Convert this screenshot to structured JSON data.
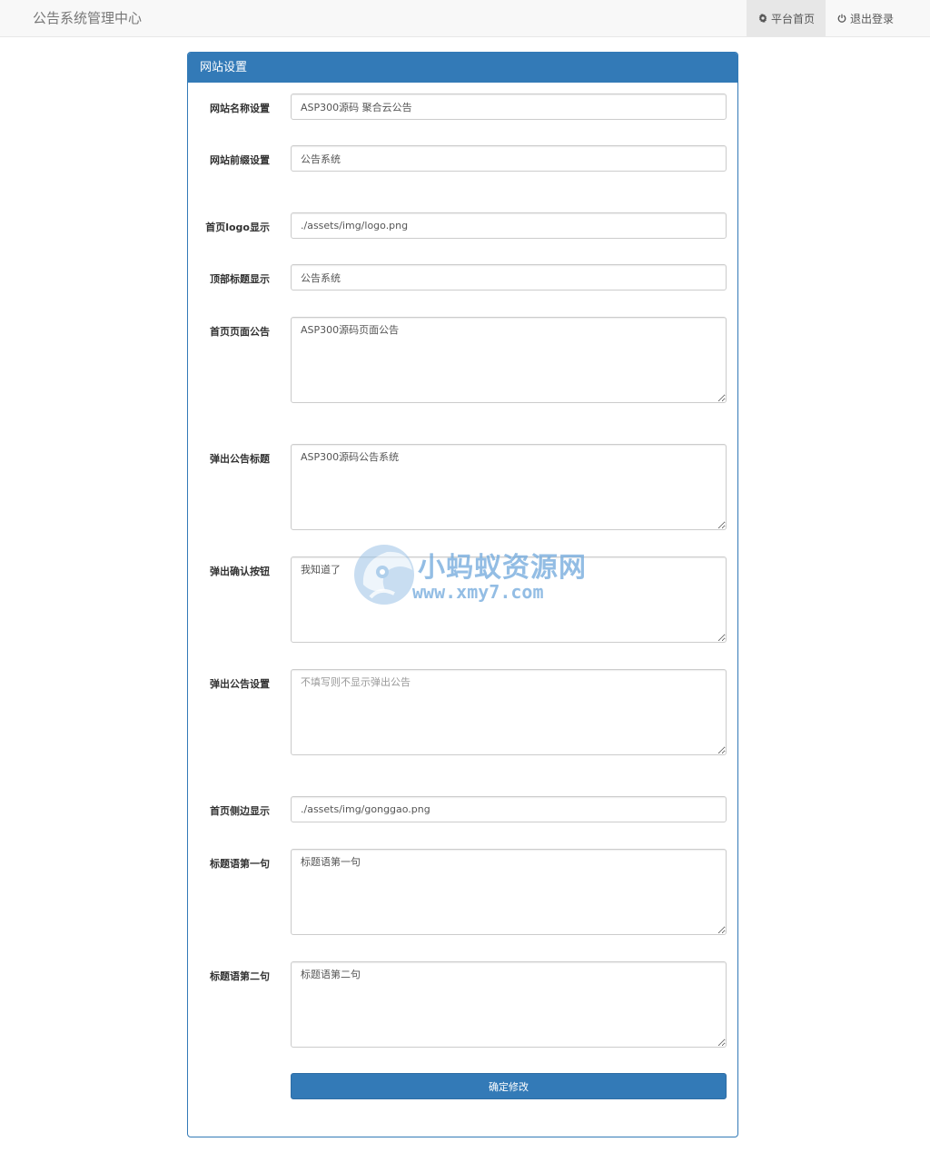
{
  "navbar": {
    "brand": "公告系统管理中心",
    "links": [
      {
        "label": "平台首页",
        "icon": "gear-icon",
        "active": true
      },
      {
        "label": "退出登录",
        "icon": "power-icon",
        "active": false
      }
    ]
  },
  "panel": {
    "title": "网站设置",
    "fields": [
      {
        "label": "网站名称设置",
        "type": "input",
        "value": "ASP300源码 聚合云公告",
        "placeholder": ""
      },
      {
        "label": "网站前缀设置",
        "type": "input",
        "value": "公告系统",
        "placeholder": ""
      },
      {
        "label": "首页logo显示",
        "type": "input",
        "value": "./assets/img/logo.png",
        "placeholder": ""
      },
      {
        "label": "顶部标题显示",
        "type": "input",
        "value": "公告系统",
        "placeholder": ""
      },
      {
        "label": "首页页面公告",
        "type": "textarea",
        "value": "ASP300源码页面公告",
        "placeholder": ""
      },
      {
        "label": "弹出公告标题",
        "type": "textarea",
        "value": "ASP300源码公告系统",
        "placeholder": ""
      },
      {
        "label": "弹出确认按钮",
        "type": "textarea",
        "value": "我知道了",
        "placeholder": ""
      },
      {
        "label": "弹出公告设置",
        "type": "textarea",
        "value": "",
        "placeholder": "不填写则不显示弹出公告"
      },
      {
        "label": "首页侧边显示",
        "type": "input",
        "value": "./assets/img/gonggao.png",
        "placeholder": ""
      },
      {
        "label": "标题语第一句",
        "type": "textarea",
        "value": "标题语第一句",
        "placeholder": ""
      },
      {
        "label": "标题语第二句",
        "type": "textarea",
        "value": "标题语第二句",
        "placeholder": ""
      }
    ],
    "submit_label": "确定修改"
  },
  "watermark": {
    "title": "小蚂蚁资源网",
    "url": "www.xmy7.com"
  },
  "colors": {
    "primary": "#337ab7",
    "navbar_bg": "#f8f8f8",
    "active_nav_bg": "#e7e7e7"
  }
}
